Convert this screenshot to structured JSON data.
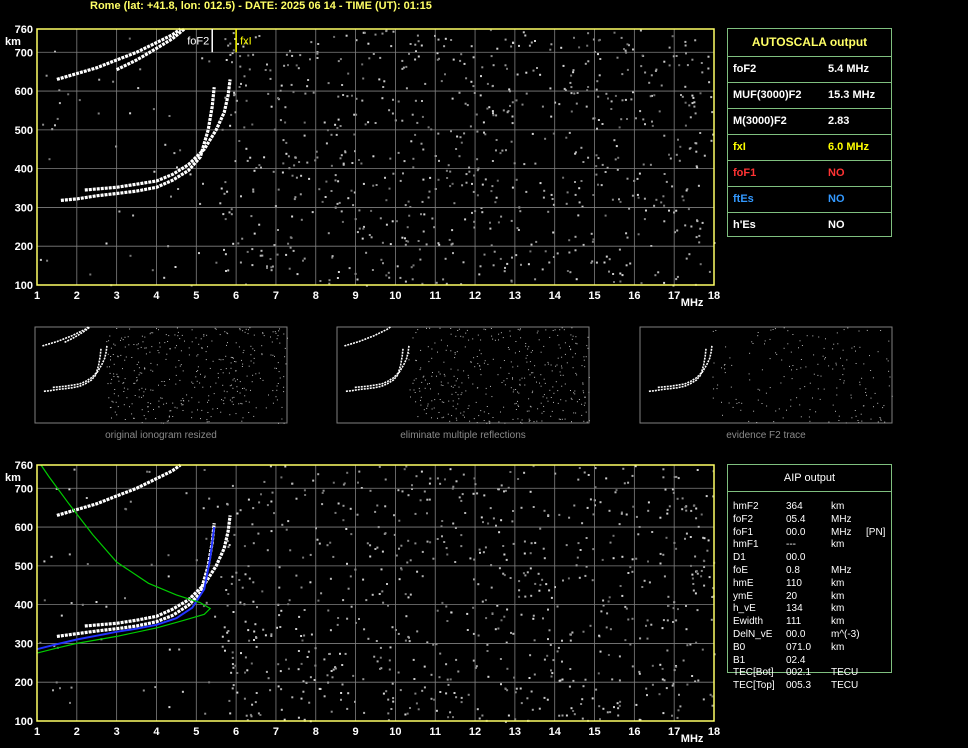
{
  "header": "Rome (lat: +41.8, lon: 012.5) - DATE: 2025 06 14 - TIME (UT): 01:15",
  "colors": {
    "grid": "#808080",
    "axis": "#ffff66",
    "trace": "#ffffff",
    "border": "#7fbf7f",
    "aip_profile": "#2233ff",
    "aip_model": "#00cc00",
    "fxi": "#ffff00",
    "fof1": "#ff3333",
    "ftes": "#3399ff"
  },
  "chart_data": [
    {
      "type": "scatter",
      "name": "autoscaled_ionogram",
      "xlabel": "MHz",
      "ylabel": "km",
      "xlim": [
        1,
        18
      ],
      "ylim": [
        100,
        760
      ],
      "xticks": [
        "1",
        "2",
        "3",
        "4",
        "5",
        "6",
        "7",
        "8",
        "9",
        "10",
        "11",
        "12",
        "13",
        "14",
        "15",
        "16",
        "17",
        "18"
      ],
      "yticks": [
        "100",
        "200",
        "300",
        "400",
        "500",
        "600",
        "700",
        "760"
      ],
      "grid": true,
      "annotations": {
        "foF2_label": "foF2",
        "foF2_value": 5.4,
        "fxI_label": "fxI",
        "fxI_value": 6.0
      },
      "series": [
        {
          "values": [
            [
              1.6,
              318
            ],
            [
              2.0,
              322
            ],
            [
              2.5,
              330
            ],
            [
              3.0,
              336
            ],
            [
              3.5,
              342
            ],
            [
              4.0,
              352
            ],
            [
              4.4,
              370
            ],
            [
              4.8,
              395
            ],
            [
              5.1,
              430
            ],
            [
              5.3,
              500
            ],
            [
              5.4,
              560
            ],
            [
              5.45,
              610
            ]
          ]
        },
        {
          "values": [
            [
              2.2,
              345
            ],
            [
              3.0,
              352
            ],
            [
              3.5,
              360
            ],
            [
              4.0,
              368
            ],
            [
              4.4,
              385
            ],
            [
              4.8,
              410
            ],
            [
              5.2,
              450
            ],
            [
              5.5,
              500
            ],
            [
              5.7,
              545
            ],
            [
              5.8,
              590
            ],
            [
              5.85,
              630
            ]
          ]
        },
        {
          "values": [
            [
              1.5,
              630
            ],
            [
              2.0,
              645
            ],
            [
              2.5,
              660
            ],
            [
              3.0,
              680
            ],
            [
              3.5,
              700
            ],
            [
              4.0,
              725
            ],
            [
              4.4,
              745
            ],
            [
              4.6,
              760
            ]
          ]
        },
        {
          "values": [
            [
              3.0,
              655
            ],
            [
              3.5,
              680
            ],
            [
              4.0,
              710
            ],
            [
              4.4,
              735
            ],
            [
              4.7,
              760
            ]
          ]
        }
      ]
    },
    {
      "type": "scatter",
      "name": "aip_profile",
      "xlabel": "MHz",
      "ylabel": "km",
      "xlim": [
        1,
        18
      ],
      "ylim": [
        100,
        760
      ],
      "xticks": [
        "1",
        "2",
        "3",
        "4",
        "5",
        "6",
        "7",
        "8",
        "9",
        "10",
        "11",
        "12",
        "13",
        "14",
        "15",
        "16",
        "17",
        "18"
      ],
      "yticks": [
        "100",
        "200",
        "300",
        "400",
        "500",
        "600",
        "700",
        "760"
      ],
      "grid": true,
      "series": [
        {
          "values": [
            [
              1.5,
              318
            ],
            [
              2.0,
              325
            ],
            [
              2.5,
              332
            ],
            [
              3.0,
              338
            ],
            [
              3.5,
              345
            ],
            [
              4.0,
              356
            ],
            [
              4.4,
              372
            ],
            [
              4.8,
              398
            ],
            [
              5.1,
              430
            ],
            [
              5.3,
              500
            ],
            [
              5.4,
              560
            ],
            [
              5.45,
              610
            ]
          ]
        },
        {
          "values": [
            [
              2.2,
              345
            ],
            [
              3.0,
              352
            ],
            [
              3.5,
              360
            ],
            [
              4.0,
              370
            ],
            [
              4.4,
              388
            ],
            [
              4.8,
              412
            ],
            [
              5.2,
              452
            ],
            [
              5.5,
              500
            ],
            [
              5.7,
              545
            ],
            [
              5.8,
              590
            ],
            [
              5.85,
              630
            ]
          ]
        },
        {
          "values": [
            [
              1.5,
              630
            ],
            [
              2.0,
              645
            ],
            [
              2.5,
              660
            ],
            [
              3.0,
              680
            ],
            [
              3.5,
              700
            ],
            [
              4.0,
              725
            ],
            [
              4.4,
              745
            ],
            [
              4.6,
              760
            ]
          ]
        },
        {
          "values": [
            [
              1.0,
              285
            ],
            [
              1.5,
              298
            ],
            [
              2.0,
              310
            ],
            [
              2.5,
              320
            ],
            [
              3.0,
              330
            ],
            [
              3.5,
              338
            ],
            [
              4.0,
              348
            ],
            [
              4.5,
              365
            ],
            [
              4.9,
              392
            ],
            [
              5.2,
              440
            ],
            [
              5.35,
              520
            ],
            [
              5.45,
              600
            ]
          ]
        },
        {
          "values": [
            [
              1.0,
              275
            ],
            [
              1.5,
              288
            ],
            [
              2.0,
              300
            ],
            [
              3.0,
              318
            ],
            [
              4.0,
              340
            ],
            [
              4.7,
              360
            ],
            [
              5.2,
              375
            ],
            [
              5.35,
              390
            ],
            [
              5.1,
              405
            ],
            [
              4.5,
              425
            ],
            [
              3.8,
              455
            ],
            [
              3.0,
              510
            ],
            [
              2.4,
              580
            ],
            [
              1.8,
              660
            ],
            [
              1.3,
              730
            ],
            [
              1.1,
              760
            ]
          ]
        }
      ]
    }
  ],
  "autoscala": {
    "title": "AUTOSCALA output",
    "rows": [
      {
        "label": "foF2",
        "value": "5.4 MHz"
      },
      {
        "label": "MUF(3000)F2",
        "value": "15.3 MHz"
      },
      {
        "label": "M(3000)F2",
        "value": "2.83"
      },
      {
        "label": "fxI",
        "value": "6.0 MHz"
      },
      {
        "label": "foF1",
        "value": "NO"
      },
      {
        "label": "ftEs",
        "value": "NO"
      },
      {
        "label": "h'Es",
        "value": "NO"
      }
    ]
  },
  "aip": {
    "title": "AIP output",
    "rows": [
      {
        "name": "hmF2",
        "value": "364",
        "unit": "km",
        "extra": ""
      },
      {
        "name": "foF2",
        "value": "05.4",
        "unit": "MHz",
        "extra": ""
      },
      {
        "name": "foF1",
        "value": "00.0",
        "unit": "MHz",
        "extra": "[PN]"
      },
      {
        "name": "hmF1",
        "value": "---",
        "unit": "km",
        "extra": ""
      },
      {
        "name": "D1",
        "value": "00.0",
        "unit": "",
        "extra": ""
      },
      {
        "name": "foE",
        "value": "0.8",
        "unit": "MHz",
        "extra": ""
      },
      {
        "name": "hmE",
        "value": "110",
        "unit": "km",
        "extra": ""
      },
      {
        "name": "ymE",
        "value": "20",
        "unit": "km",
        "extra": ""
      },
      {
        "name": "h_vE",
        "value": "134",
        "unit": "km",
        "extra": ""
      },
      {
        "name": "Ewidth",
        "value": "111",
        "unit": "km",
        "extra": ""
      },
      {
        "name": "DelN_vE",
        "value": "00.0",
        "unit": "m^(-3)",
        "extra": ""
      },
      {
        "name": "B0",
        "value": "071.0",
        "unit": "km",
        "extra": ""
      },
      {
        "name": "B1",
        "value": "02.4",
        "unit": "",
        "extra": ""
      },
      {
        "name": "TEC[Bot]",
        "value": "002.1",
        "unit": "TECU",
        "extra": ""
      },
      {
        "name": "TEC[Top]",
        "value": "005.3",
        "unit": "TECU",
        "extra": ""
      }
    ]
  },
  "thumbnails": [
    {
      "caption": "original ionogram resized"
    },
    {
      "caption": "eliminate multiple reflections"
    },
    {
      "caption": "evidence F2 trace"
    }
  ]
}
